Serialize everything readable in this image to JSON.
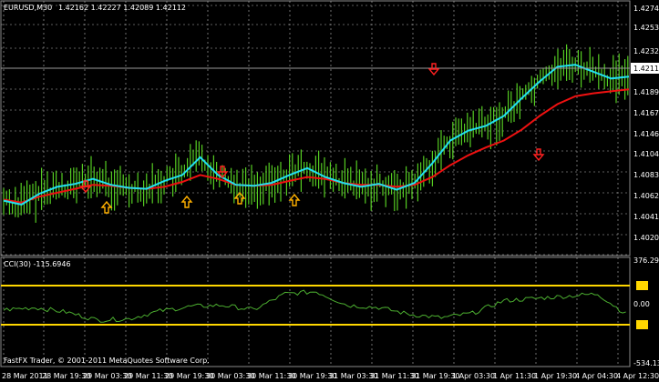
{
  "main_header": {
    "symbol_timeframe": "EURUSD,M30",
    "ohlc": "1.42162 1.42227 1.42089 1.42112"
  },
  "indicator_header": "CCI(30) -115.6946",
  "copyright": "FastFX Trader, © 2001-2011 MetaQuotes Software Corp.",
  "price_axis": [
    "1.42745",
    "1.42530",
    "1.42320",
    "1.42112",
    "1.41895",
    "1.41675",
    "1.41460",
    "1.41045",
    "1.40835",
    "1.40625",
    "1.40410",
    "1.40200"
  ],
  "current_price": "1.42112",
  "cci_axis": [
    "376.293",
    "100",
    "0.00",
    "-150",
    "-534.13"
  ],
  "time_axis": [
    "28 Mar 2011",
    "28 Mar 19:30",
    "29 Mar 03:30",
    "29 Mar 11:30",
    "29 Mar 19:30",
    "30 Mar 03:30",
    "30 Mar 11:30",
    "30 Mar 19:30",
    "31 Mar 03:30",
    "31 Mar 11:30",
    "31 Mar 19:30",
    "1 Apr 03:30",
    "1 Apr 11:30",
    "1 Apr 19:30",
    "4 Apr 04:30",
    "4 Apr 12:30"
  ],
  "colors": {
    "background": "#000000",
    "candles": "#55cc22",
    "fast_ma": "#22e0f0",
    "slow_ma": "#ee1111",
    "grid": "#b8b8b8",
    "cci_line": "#4caf30",
    "levels": "#ffd700",
    "buy_arrow": "#ffb000",
    "sell_arrow": "#ff2020",
    "axis_text": "#ffffff"
  },
  "icons": {
    "buy_signal": "up-arrow-icon",
    "sell_signal": "down-arrow-icon"
  },
  "chart_data": [
    {
      "type": "line",
      "x": [
        0,
        10,
        20,
        30,
        40,
        50,
        60,
        70,
        80,
        90,
        100,
        110,
        120,
        130,
        140,
        150,
        160,
        170,
        180,
        190,
        200,
        210,
        220,
        230,
        240,
        250,
        260,
        270,
        280,
        290,
        300,
        310,
        320,
        330,
        340,
        350
      ],
      "series": [
        {
          "values": [
            1.4074,
            1.407,
            1.4081,
            1.4088,
            1.4091,
            1.4096,
            1.409,
            1.4087,
            1.4086,
            1.4094,
            1.41,
            1.4118,
            1.41,
            1.409,
            1.4089,
            1.4092,
            1.41,
            1.4107,
            1.4098,
            1.4092,
            1.4088,
            1.4091,
            1.4085,
            1.4092,
            1.4112,
            1.4135,
            1.4145,
            1.415,
            1.416,
            1.4178,
            1.4195,
            1.421,
            1.4212,
            1.4205,
            1.4198,
            1.42
          ]
        },
        {
          "values": [
            1.4075,
            1.4072,
            1.4078,
            1.4082,
            1.4086,
            1.409,
            1.4089,
            1.4087,
            1.4086,
            1.4088,
            1.4093,
            1.41,
            1.4096,
            1.409,
            1.4089,
            1.409,
            1.4094,
            1.4098,
            1.4096,
            1.4092,
            1.409,
            1.409,
            1.4088,
            1.409,
            1.4098,
            1.411,
            1.412,
            1.4128,
            1.4135,
            1.4146,
            1.416,
            1.4172,
            1.418,
            1.4183,
            1.4185,
            1.4187
          ]
        }
      ],
      "ylim": [
        1.402,
        1.4275
      ]
    },
    {
      "type": "line",
      "ylim": [
        -534.13,
        376.293
      ],
      "levels": [
        100,
        0,
        -150
      ],
      "x": [
        0,
        20,
        40,
        60,
        80,
        100,
        120,
        140,
        160,
        180,
        200,
        220,
        240,
        260,
        280,
        300,
        320,
        340,
        360,
        380,
        400
      ],
      "values": [
        -60,
        -40,
        -80,
        -150,
        -140,
        -70,
        -30,
        -20,
        -60,
        80,
        100,
        -20,
        -40,
        -100,
        -130,
        -90,
        20,
        40,
        60,
        80,
        -116
      ]
    }
  ]
}
